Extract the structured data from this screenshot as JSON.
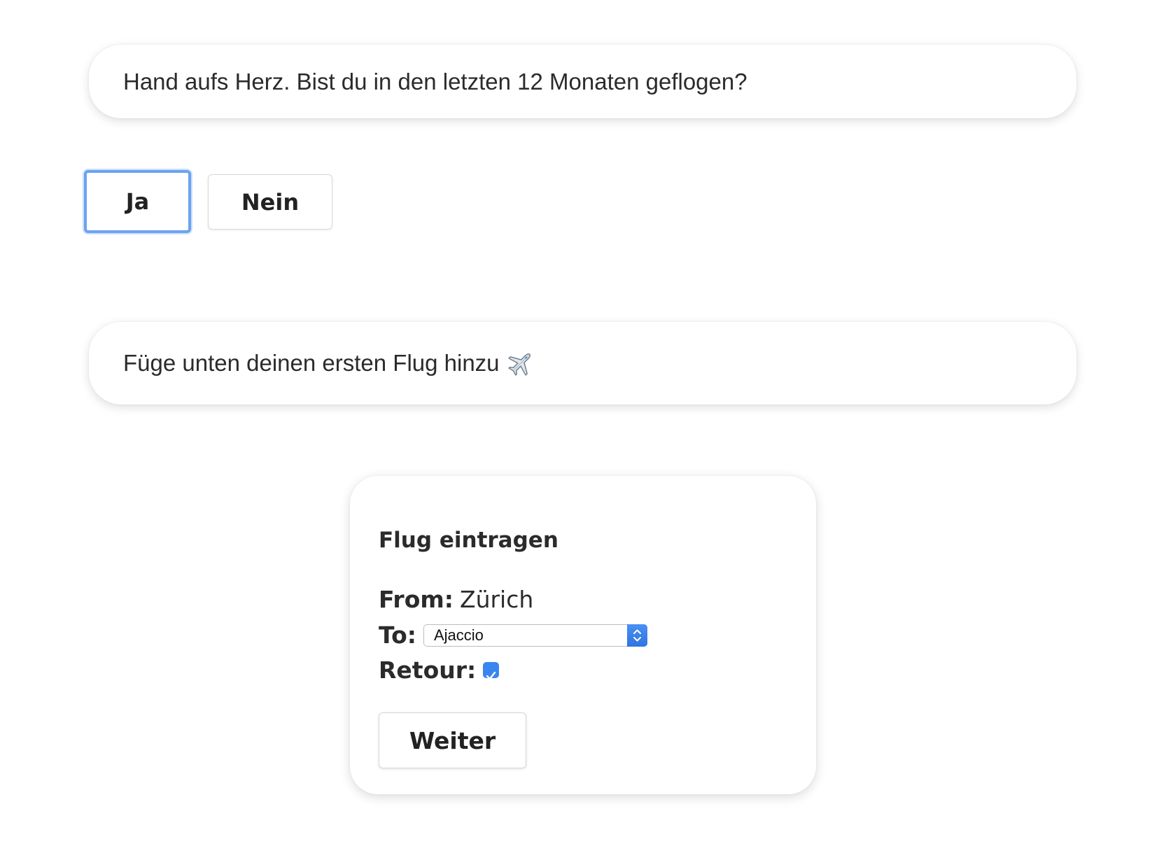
{
  "question": {
    "text": "Hand aufs Herz. Bist du in den letzten 12 Monaten geflogen?"
  },
  "choices": {
    "yes_label": "Ja",
    "no_label": "Nein",
    "selected": "Ja",
    "focus_color": "#6aa3f2"
  },
  "prompt": {
    "text": "Füge unten deinen ersten Flug hinzu",
    "icon": "airplane-emoji"
  },
  "flight_form": {
    "title": "Flug eintragen",
    "from_label": "From:",
    "from_value": "Zürich",
    "to_label": "To:",
    "to_value": "Ajaccio",
    "retour_label": "Retour:",
    "retour_checked": true,
    "submit_label": "Weiter",
    "accent_color": "#3a86f0"
  }
}
